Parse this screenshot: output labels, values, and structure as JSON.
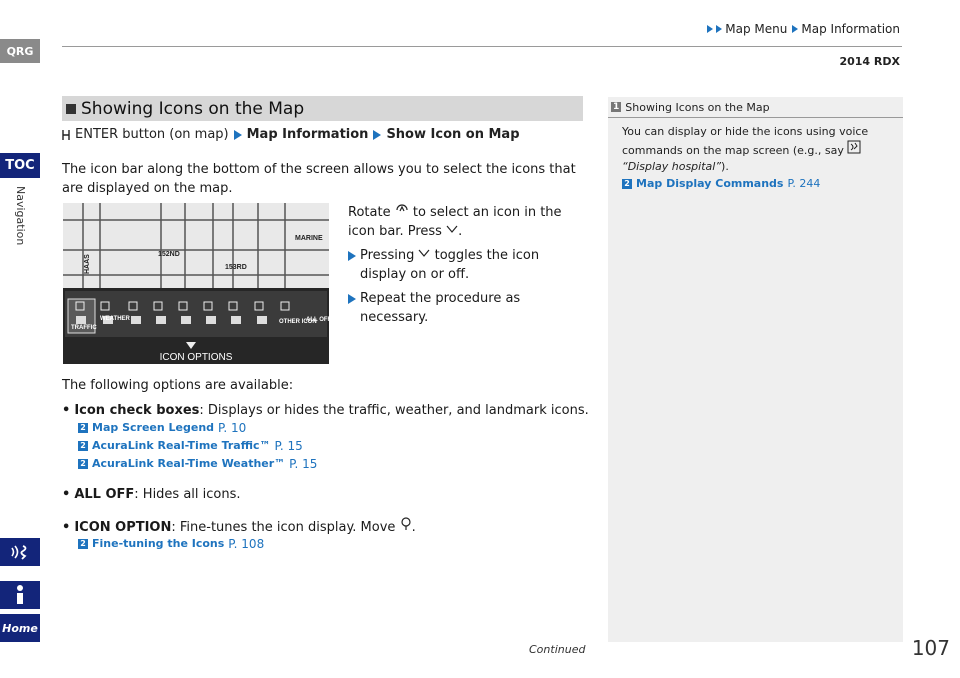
{
  "header": {
    "breadcrumb": [
      "Map Menu",
      "Map Information"
    ],
    "model": "2014 RDX"
  },
  "sidebar": {
    "qrg": "QRG",
    "toc": "TOC",
    "section": "Navigation",
    "buttons": [
      "voice-command-icon",
      "info-icon",
      "home-icon"
    ],
    "home_label": "Home"
  },
  "main": {
    "section_title": "Showing Icons on the Map",
    "path": {
      "start": "ENTER button (on map)",
      "step1": "Map Information",
      "step2": "Show Icon on Map"
    },
    "intro": "The icon bar along the bottom of the screen allows you to select the icons that are displayed on the map.",
    "steps": {
      "rotate": "Rotate",
      "rotate_rest": "to select an icon in the icon bar. Press",
      "pressing": "Pressing",
      "pressing_rest": "toggles the icon display on or off.",
      "repeat": "Repeat the procedure as necessary."
    },
    "map_screen": {
      "streets": [
        "MARINE",
        "152ND",
        "153RD",
        "HAAS"
      ],
      "icon_labels": [
        "TRAFFIC",
        "WEATHER",
        "OTHER ICON",
        "ALL OFF"
      ],
      "footer": "ICON OPTIONS"
    },
    "options_intro": "The following options are available:",
    "options": [
      {
        "name": "Icon check boxes",
        "desc": ": Displays or hides the traffic, weather, and landmark icons."
      },
      {
        "name": "ALL OFF",
        "desc": ": Hides all icons."
      },
      {
        "name": "ICON OPTION",
        "desc": ": Fine-tunes the icon display. Move"
      }
    ],
    "refs1": [
      {
        "text": "Map Screen Legend",
        "page": "P. 10"
      },
      {
        "text": "AcuraLink Real-Time Traffic™",
        "page": "P. 15"
      },
      {
        "text": "AcuraLink Real-Time Weather™",
        "page": "P. 15"
      }
    ],
    "refs2": [
      {
        "text": "Fine-tuning the Icons",
        "page": "P. 108"
      }
    ]
  },
  "sidenote": {
    "title": "Showing Icons on the Map",
    "body": "You can display or hide the icons using voice commands on the map screen (e.g., say",
    "example": "“Display hospital”",
    "ref": {
      "text": "Map Display Commands",
      "page": "P. 244"
    }
  },
  "footer": {
    "continued": "Continued",
    "page": "107"
  },
  "colors": {
    "accent": "#1e73be",
    "toc": "#13257a",
    "section_bar": "#d7d7d7",
    "panel": "#efefef"
  }
}
